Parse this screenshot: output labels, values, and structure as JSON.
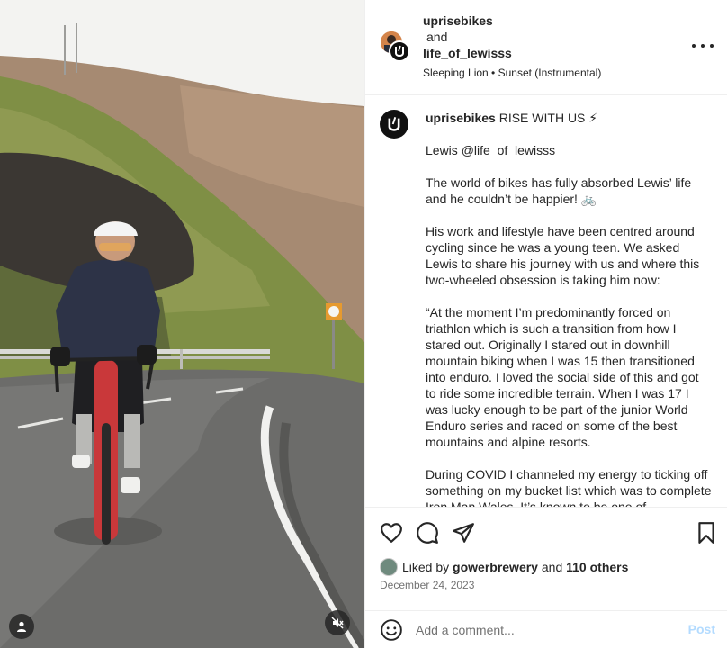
{
  "header": {
    "author": "uprisebikes",
    "joiner": "and",
    "collaborator": "life_of_lewisss",
    "audio": "Sleeping Lion • Sunset (Instrumental)",
    "more_icon": "more-horizontal-icon"
  },
  "caption": {
    "author": "uprisebikes",
    "headline": "RISE WITH US ⚡",
    "p1_text": "Lewis ",
    "p1_mention": "@life_of_lewisss",
    "p2": "The world of bikes has fully absorbed Lewis’ life and he couldn’t be happier! 🚲",
    "p3": "His work and lifestyle have been centred around cycling since he was a young teen. We asked Lewis to share his journey with us and where this two-wheeled obsession is taking him now:",
    "p4": "“At the moment I’m predominantly forced on triathlon which is such a transition from how I stared out. Originally I stared out in downhill mountain biking when I was 15 then transitioned into enduro. I loved the social side of this and got to ride some incredible terrain. When I was 17 I was lucky enough to be part of the junior World Enduro series and raced on some of the best mountains and alpine resorts.",
    "p5": "During COVID I channeled my energy to ticking off something on my bucket list which was to complete Iron Man Wales. It’s known to be one of"
  },
  "actions": {
    "likes_prefix": "Liked by",
    "liker": "gowerbrewery",
    "likes_joiner": "and",
    "likes_count": "110 others",
    "date": "December 24, 2023"
  },
  "comment": {
    "placeholder": "Add a comment...",
    "post_label": "Post"
  },
  "colors": {
    "accent_disabled": "#b3dbff",
    "border": "#efefef",
    "muted_text": "#737373"
  }
}
